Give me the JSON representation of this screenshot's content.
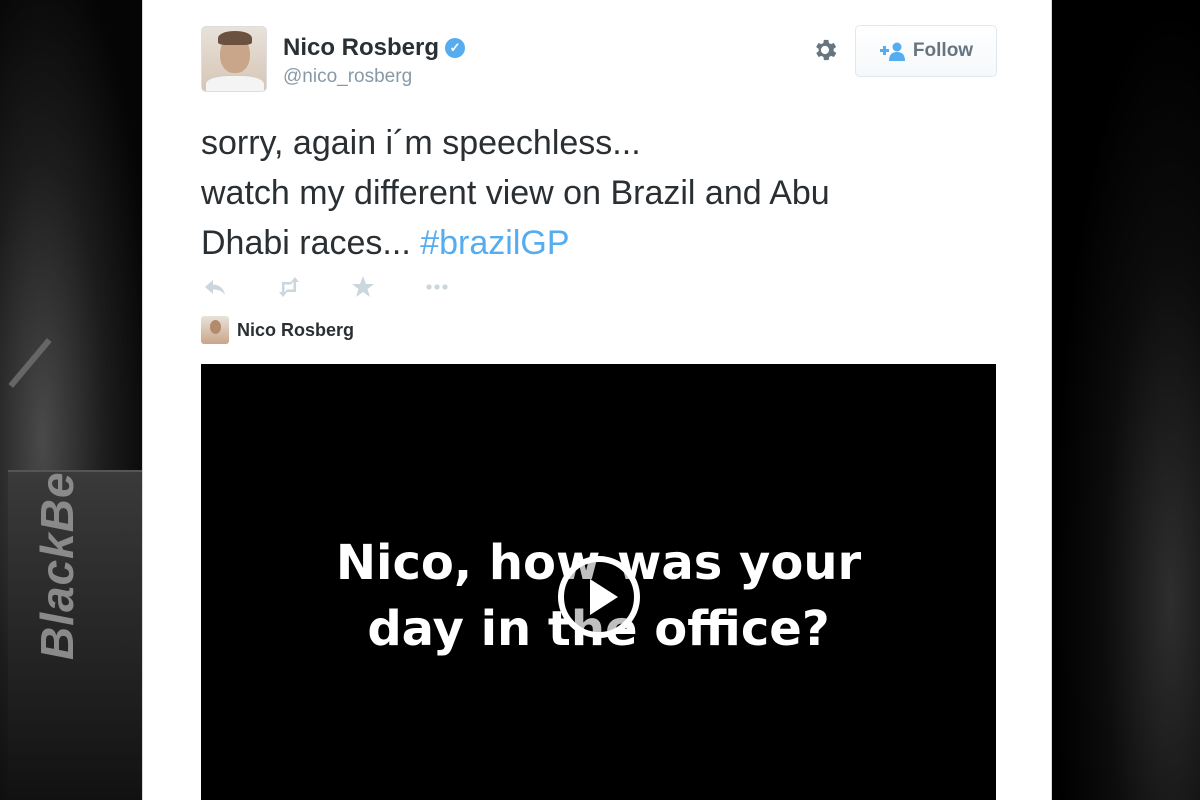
{
  "tweet": {
    "author_name": "Nico Rosberg",
    "handle": "@nico_rosberg",
    "verified": true,
    "follow_label": "Follow",
    "text_lines": [
      "sorry, again i´m speechless...",
      "watch my different view on Brazil and Abu",
      "Dhabi races... "
    ],
    "hashtag": "#brazilGP"
  },
  "embed": {
    "author_name": "Nico Rosberg",
    "video_caption_line1": "Nico, how was your",
    "video_caption_line2": "day in the office?"
  },
  "background": {
    "brand_text": "BlackBe"
  },
  "icons": {
    "settings": "gear-icon",
    "follow": "add-user-icon",
    "reply": "reply-icon",
    "retweet": "retweet-icon",
    "favorite": "star-icon",
    "more": "more-icon",
    "play": "play-icon"
  },
  "colors": {
    "accent": "#55acee",
    "text": "#292f33",
    "muted": "#8899a6",
    "icon": "#8899a6"
  }
}
